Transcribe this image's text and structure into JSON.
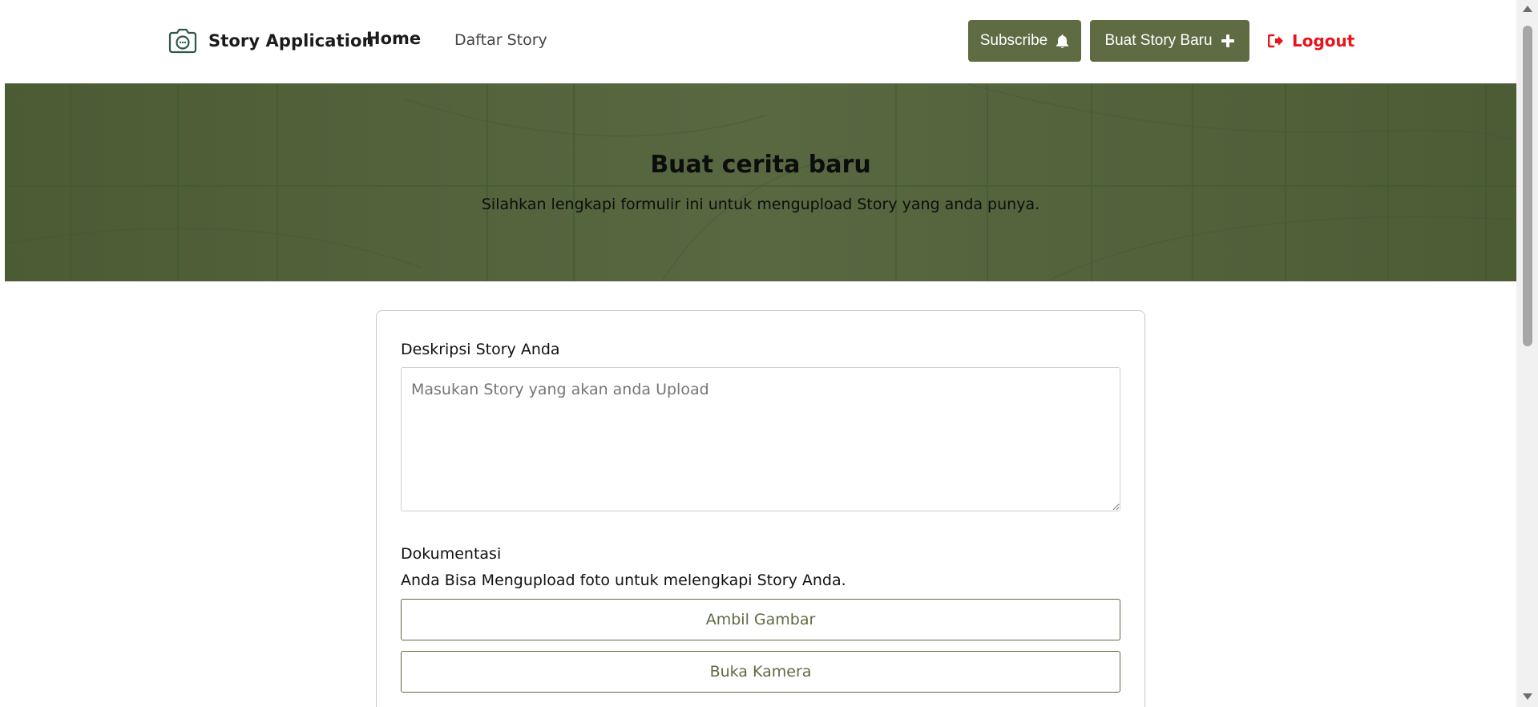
{
  "header": {
    "brand_name": "Story Application",
    "nav_home": "Home",
    "nav_daftar": "Daftar Story",
    "subscribe_label": "Subscribe",
    "buat_label": "Buat Story Baru",
    "logout_label": "Logout"
  },
  "hero": {
    "title": "Buat cerita baru",
    "subtitle": "Silahkan lengkapi formulir ini untuk mengupload Story yang anda punya."
  },
  "form": {
    "desc_label": "Deskripsi Story Anda",
    "desc_placeholder": "Masukan Story yang akan anda Upload",
    "dok_label": "Dokumentasi",
    "dok_sub": "Anda Bisa Mengupload foto untuk melengkapi Story Anda.",
    "ambil_label": "Ambil Gambar",
    "kamera_label": "Buka Kamera"
  },
  "colors": {
    "accent": "#5f6b43",
    "hero_bg": "#52623a",
    "logout": "#e8141c"
  },
  "icons": {
    "brand": "camera-icon",
    "subscribe": "bell-icon",
    "buat": "plus-icon",
    "logout": "sign-out-icon"
  }
}
